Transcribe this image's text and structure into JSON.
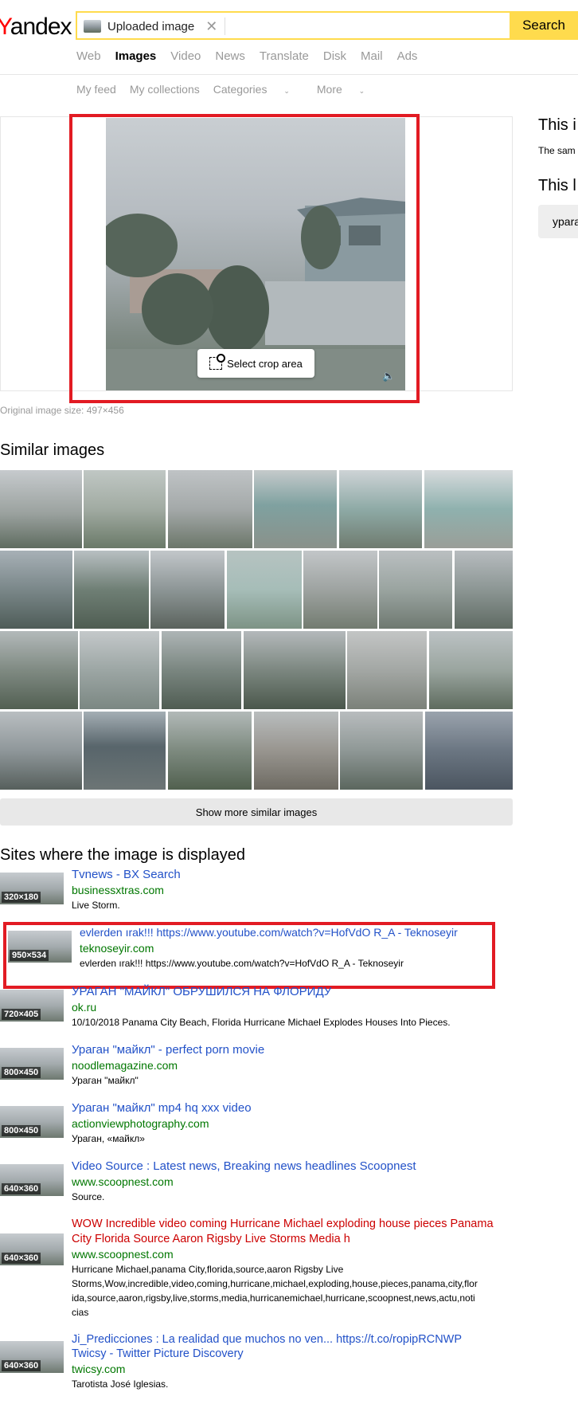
{
  "header": {
    "logo_y": "Y",
    "logo_rest": "andex",
    "search_chip_label": "Uploaded image",
    "search_button": "Search"
  },
  "tabs": [
    "Web",
    "Images",
    "Video",
    "News",
    "Translate",
    "Disk",
    "Mail",
    "Ads"
  ],
  "active_tab": "Images",
  "subnav": [
    "My feed",
    "My collections",
    "Categories",
    "More"
  ],
  "preview": {
    "crop_button": "Select crop area",
    "original_size": "Original image size: 497×456"
  },
  "right_column": {
    "heading1": "This i",
    "text1": "The sam",
    "heading2": "This l",
    "chip": "ypara"
  },
  "similar": {
    "title": "Similar images",
    "show_more": "Show more similar images"
  },
  "sites": {
    "title": "Sites where the image is displayed",
    "results": [
      {
        "dim": "320×180",
        "title": "Tvnews - BX Search",
        "url": "businessxtras.com",
        "desc": "Live Storm."
      },
      {
        "dim": "950×534",
        "title": "evlerden ırak!!! https://www.youtube.com/watch?v=HofVdO R_A - Teknoseyir",
        "url": "teknoseyir.com",
        "desc": "evlerden ırak!!! https://www.youtube.com/watch?v=HofVdO R_A - Teknoseyir"
      },
      {
        "dim": "720×405",
        "title": "УРАГАН \"МАЙКЛ\" ОБРУШИЛСЯ НА ФЛОРИДУ",
        "url": "ok.ru",
        "desc": "10/10/2018 Panama City Beach, Florida Hurricane Michael Explodes Houses Into Pieces."
      },
      {
        "dim": "800×450",
        "title": "Ураган \"майкл\" - perfect porn movie",
        "url": "noodlemagazine.com",
        "desc": "Ураган \"майкл\""
      },
      {
        "dim": "800×450",
        "title": "Ураган \"майкл\" mp4 hq xxx video",
        "url": "actionviewphotography.com",
        "desc": "Ураган, «майкл»"
      },
      {
        "dim": "640×360",
        "title": "Video Source : Latest news, Breaking news headlines Scoopnest",
        "url": "www.scoopnest.com",
        "desc": "Source."
      },
      {
        "dim": "640×360",
        "title_line1": "WOW Incredible video coming Hurricane Michael exploding house pieces Panama",
        "title_line2": "City Florida Source Aaron Rigsby Live Storms Media h",
        "url": "www.scoopnest.com",
        "desc_lines": [
          "Hurricane Michael,panama City,florida,source,aaron Rigsby Live",
          "Storms,Wow,incredible,video,coming,hurricane,michael,exploding,house,pieces,panama,city,flor",
          "ida,source,aaron,rigsby,live,storms,media,hurricanemichael,hurricane,scoopnest,news,actu,noti",
          "cias"
        ]
      },
      {
        "dim": "640×360",
        "title_line1": "Ji_Predicciones : La realidad que muchos no ven... https://t.co/ropipRCNWP",
        "title_line2": "Twicsy - Twitter Picture Discovery",
        "url": "twicsy.com",
        "desc": "Tarotista José Iglesias."
      }
    ]
  },
  "colors": {
    "accent": "#ffdb4d",
    "link": "#2251c8",
    "url": "#007700",
    "highlight_red": "#e21b23",
    "visited_red": "#cc0000"
  }
}
